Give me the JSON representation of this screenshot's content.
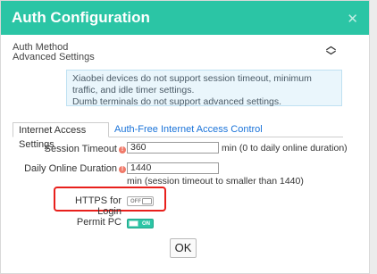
{
  "dialog": {
    "title": "Auth Configuration",
    "close_icon": "close-icon",
    "sections": {
      "auth_method": "Auth Method",
      "advanced_settings": "Advanced Settings"
    },
    "info": {
      "line1": "Xiaobei devices do not support session timeout, minimum traffic, and idle timer settings.",
      "line2": "Dumb terminals do not support advanced settings."
    },
    "tabs": [
      {
        "label": "Internet Access Settings",
        "active": true
      },
      {
        "label": "Auth-Free",
        "active": false
      },
      {
        "label": "Internet Access Control",
        "active": false
      }
    ],
    "fields": {
      "session_timeout": {
        "label": "Session Timeout",
        "value": "360",
        "hint": "min (0 to daily online duration)"
      },
      "daily_online_duration": {
        "label": "Daily Online Duration",
        "value": "1440",
        "hint": "min (session timeout to smaller than 1440)"
      },
      "https_for_login": {
        "label": "HTTPS for Login",
        "state": "OFF"
      },
      "permit_pc": {
        "label": "Permit PC",
        "state": "ON"
      }
    },
    "ok_label": "OK"
  },
  "colors": {
    "titlebar": "#2bc5a5",
    "highlight": "#e8201c",
    "link": "#1a73d9",
    "required": "#f07a6a"
  }
}
